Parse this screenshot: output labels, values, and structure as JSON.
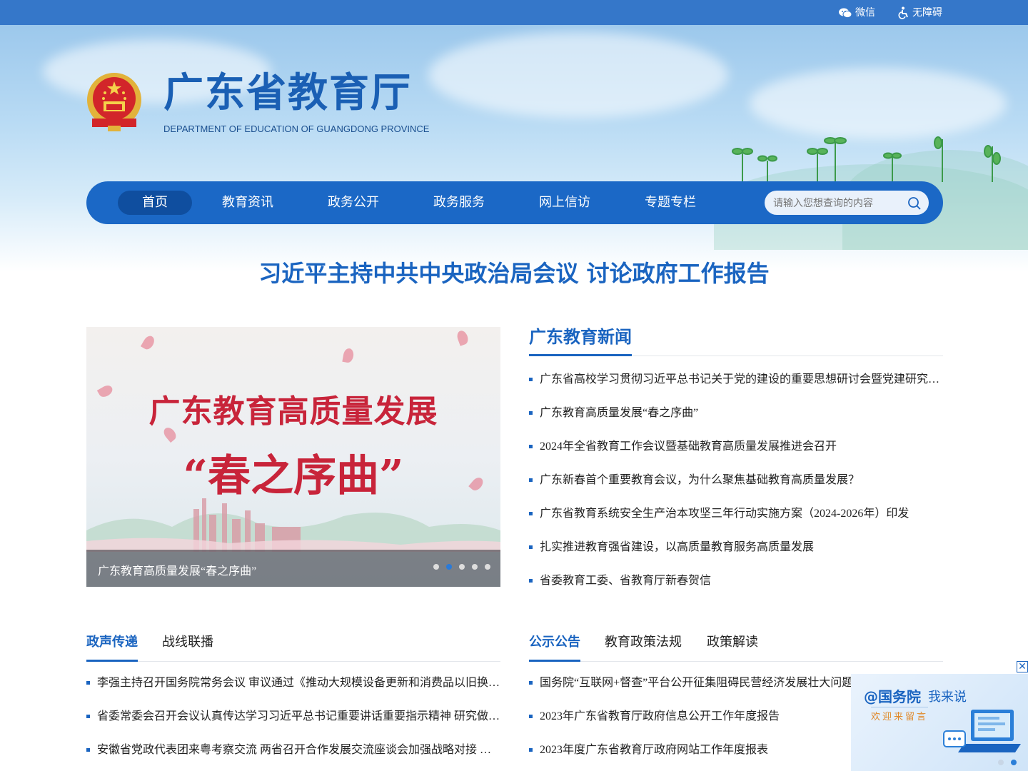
{
  "topbar": {
    "wechat_label": "微信",
    "accessibility_label": "无障碍"
  },
  "header": {
    "title": "广东省教育厅",
    "subtitle": "DEPARTMENT OF EDUCATION OF GUANGDONG PROVINCE"
  },
  "nav": {
    "items": [
      {
        "label": "首页",
        "active": true
      },
      {
        "label": "教育资讯"
      },
      {
        "label": "政务公开"
      },
      {
        "label": "政务服务"
      },
      {
        "label": "网上信访"
      },
      {
        "label": "专题专栏"
      }
    ],
    "search_placeholder": "请输入您想查询的内容"
  },
  "headline": "习近平主持中共中央政治局会议 讨论政府工作报告",
  "slider": {
    "image_line1": "广东教育高质量发展",
    "image_line2": "“春之序曲”",
    "caption": "广东教育高质量发展“春之序曲”",
    "dot_count": 5,
    "active_dot": 2
  },
  "news": {
    "title": "广东教育新闻",
    "items": [
      "广东省高校学习贯彻习近平总书记关于党的建设的重要思想研讨会暨党建研究会年会召开",
      "广东教育高质量发展“春之序曲”",
      "2024年全省教育工作会议暨基础教育高质量发展推进会召开",
      "广东新春首个重要教育会议，为什么聚焦基础教育高质量发展？",
      "广东省教育系统安全生产治本攻坚三年行动实施方案（2024-2026年）印发",
      "扎实推进教育强省建设，以高质量教育服务高质量发展",
      "省委教育工委、省教育厅新春贺信"
    ]
  },
  "left_section": {
    "tabs": [
      "政声传递",
      "战线联播"
    ],
    "items": [
      "李强主持召开国务院常务会议 审议通过《推动大规模设备更新和消费品以旧换新行动方案》",
      "省委常委会召开会议认真传达学习习近平总书记重要讲话重要指示精神 研究做好有关工作",
      "安徽省党政代表团来粤考察交流 两省召开合作发展交流座谈会加强战略对接 深化务实合作"
    ]
  },
  "right_section": {
    "tabs": [
      "公示公告",
      "教育政策法规",
      "政策解读"
    ],
    "items": [
      "国务院“互联网+督查”平台公开征集阻碍民营经济发展壮大问题线索",
      "2023年广东省教育厅政府信息公开工作年度报告",
      "2023年度广东省教育厅政府网站工作年度报表"
    ]
  },
  "float_ad": {
    "line1": "@国务院",
    "line2": "我来说",
    "line3": "欢迎来留言",
    "close_label": "✕"
  },
  "colors": {
    "primary": "#1a64c0",
    "nav_bg": "#1b68c6",
    "topbar_bg": "#3577c9",
    "slide_text": "#c8243a"
  }
}
